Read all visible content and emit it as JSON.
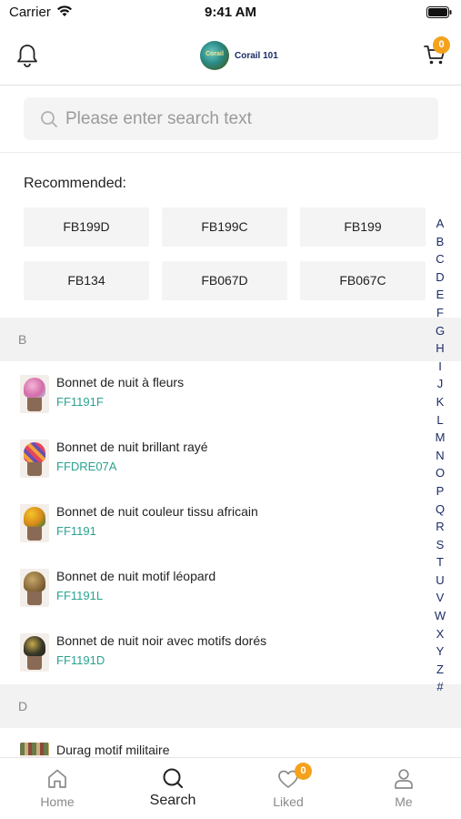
{
  "status_bar": {
    "carrier": "Carrier",
    "time": "9:41 AM"
  },
  "header": {
    "brand_name": "Corail 101",
    "brand_logo_text": "Corail",
    "cart_count": "0"
  },
  "search": {
    "placeholder": "Please enter search text",
    "value": ""
  },
  "recommended": {
    "title": "Recommended:",
    "chips": [
      "FB199D",
      "FB199C",
      "FB199",
      "FB134",
      "FB067D",
      "FB067C"
    ]
  },
  "alphabet": [
    "A",
    "B",
    "C",
    "D",
    "E",
    "F",
    "G",
    "H",
    "I",
    "J",
    "K",
    "L",
    "M",
    "N",
    "O",
    "P",
    "Q",
    "R",
    "S",
    "T",
    "U",
    "V",
    "W",
    "X",
    "Y",
    "Z",
    "#"
  ],
  "sections": [
    {
      "letter": "B",
      "items": [
        {
          "name": "Bonnet de nuit à fleurs",
          "code": "FF1191F"
        },
        {
          "name": "Bonnet de nuit brillant rayé",
          "code": "FFDRE07A"
        },
        {
          "name": "Bonnet de nuit couleur tissu africain",
          "code": "FF1191"
        },
        {
          "name": "Bonnet de nuit motif léopard",
          "code": "FF1191L"
        },
        {
          "name": "Bonnet de nuit noir avec motifs dorés",
          "code": "FF1191D"
        }
      ]
    },
    {
      "letter": "D",
      "items": [
        {
          "name": "Durag motif militaire",
          "code": ""
        }
      ]
    }
  ],
  "tabs": [
    {
      "label": "Home",
      "icon": "home-icon",
      "active": false
    },
    {
      "label": "Search",
      "icon": "search-icon",
      "active": true
    },
    {
      "label": "Liked",
      "icon": "heart-icon",
      "active": false,
      "badge": "0"
    },
    {
      "label": "Me",
      "icon": "user-icon",
      "active": false
    }
  ],
  "colors": {
    "accent": "#f4a21c",
    "code_green": "#2aa38f",
    "index_blue": "#1b2b66"
  }
}
